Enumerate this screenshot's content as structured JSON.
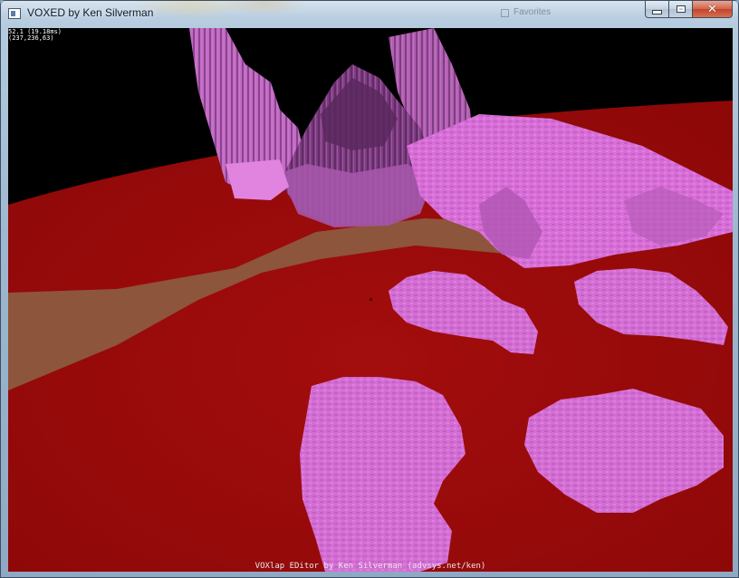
{
  "window": {
    "title": "VOXED by Ken Silverman",
    "app_icon": "window-app-icon",
    "buttons": {
      "minimize": "minimize-icon",
      "maximize": "maximize-icon",
      "close": "close-icon"
    },
    "background_window_label": "Favorites"
  },
  "hud": {
    "fps_readout": "52.1 (19.18ms)",
    "position_readout": "(237,236,63)"
  },
  "footer": {
    "credit": "VOXlap EDitor by Ken Silverman (advsys.net/ken)"
  },
  "colors": {
    "sky": "#000000",
    "ground_red": "#a80e0e",
    "dirt_path": "#8c5a3e",
    "voxel_pink": "#d46ed4",
    "voxel_dark": "#6a2f6a"
  }
}
